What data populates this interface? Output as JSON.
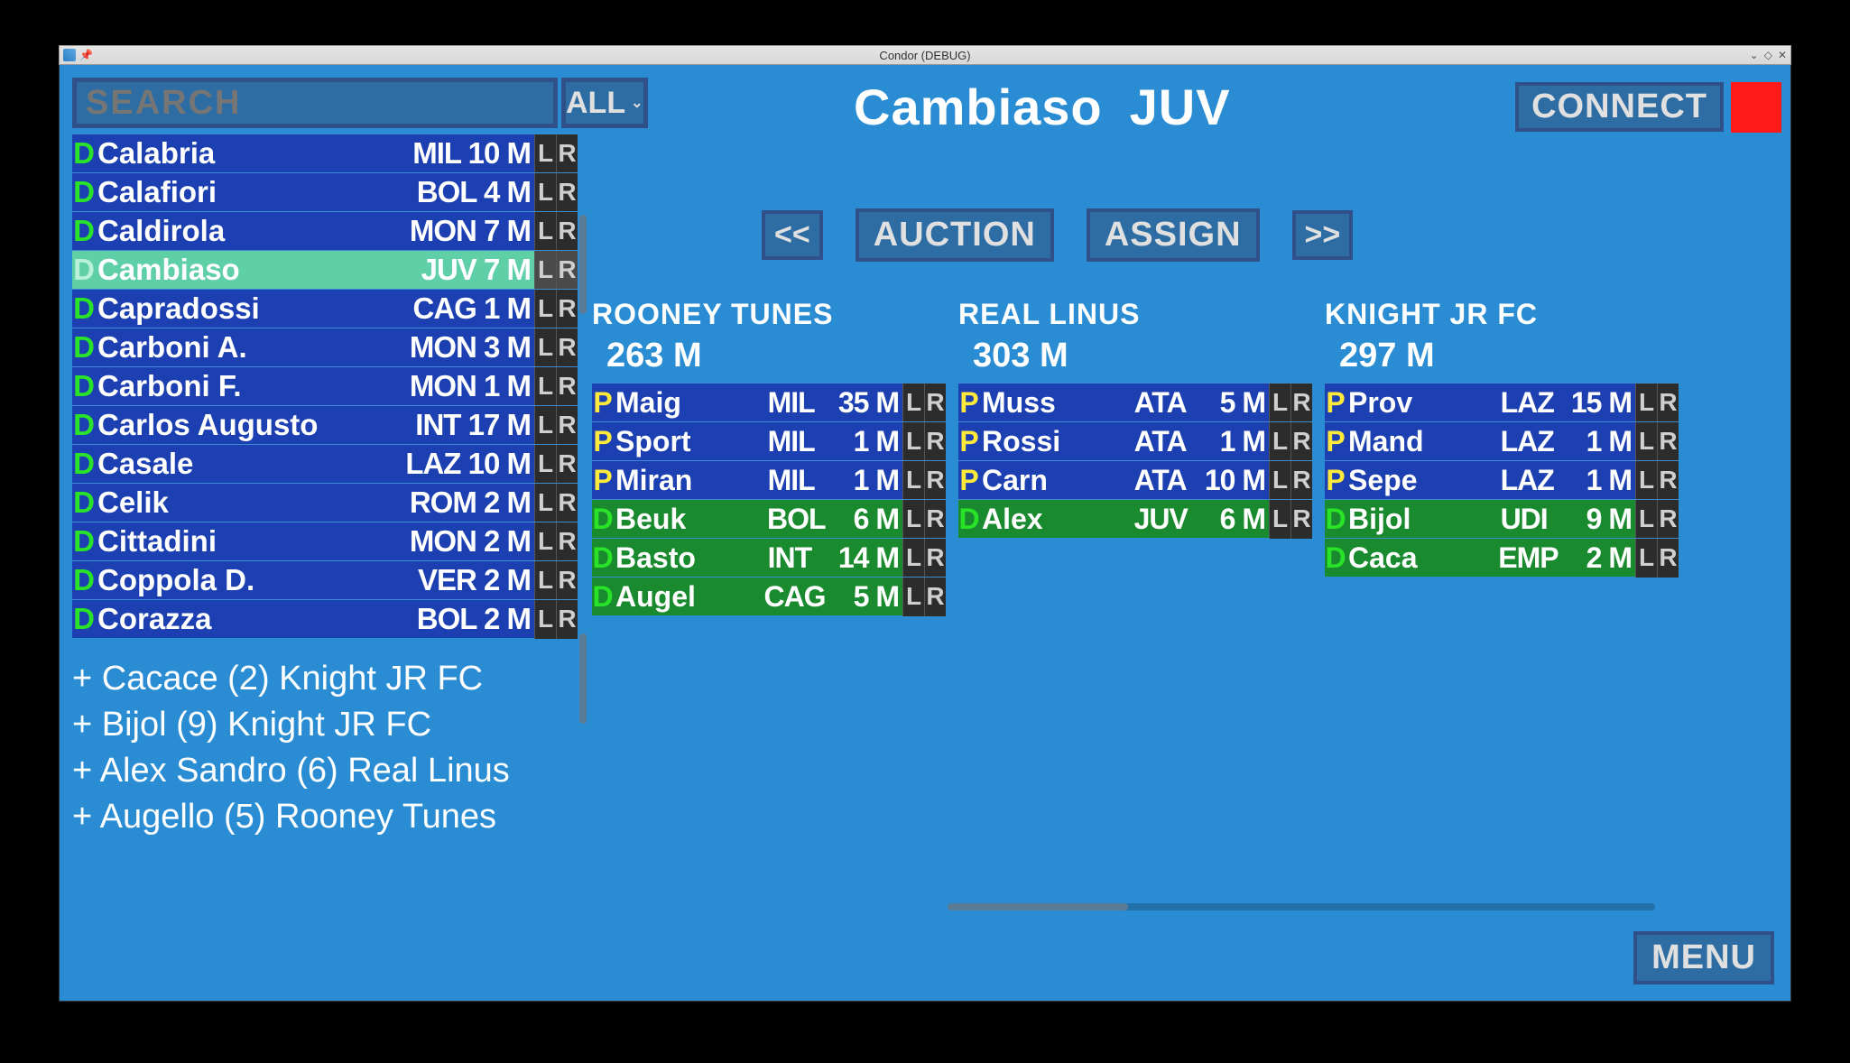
{
  "window": {
    "title": "Condor (DEBUG)"
  },
  "search": {
    "placeholder": "SEARCH",
    "filter_label": "ALL"
  },
  "player_list": [
    {
      "role": "D",
      "name": "Calabria",
      "team": "MIL",
      "value": "10",
      "unit": "M",
      "selected": false
    },
    {
      "role": "D",
      "name": "Calafiori",
      "team": "BOL",
      "value": "4",
      "unit": "M",
      "selected": false
    },
    {
      "role": "D",
      "name": "Caldirola",
      "team": "MON",
      "value": "7",
      "unit": "M",
      "selected": false
    },
    {
      "role": "D",
      "name": "Cambiaso",
      "team": "JUV",
      "value": "7",
      "unit": "M",
      "selected": true
    },
    {
      "role": "D",
      "name": "Capradossi",
      "team": "CAG",
      "value": "1",
      "unit": "M",
      "selected": false
    },
    {
      "role": "D",
      "name": "Carboni A.",
      "team": "MON",
      "value": "3",
      "unit": "M",
      "selected": false
    },
    {
      "role": "D",
      "name": "Carboni F.",
      "team": "MON",
      "value": "1",
      "unit": "M",
      "selected": false
    },
    {
      "role": "D",
      "name": "Carlos Augusto",
      "team": "INT",
      "value": "17",
      "unit": "M",
      "selected": false
    },
    {
      "role": "D",
      "name": "Casale",
      "team": "LAZ",
      "value": "10",
      "unit": "M",
      "selected": false
    },
    {
      "role": "D",
      "name": "Celik",
      "team": "ROM",
      "value": "2",
      "unit": "M",
      "selected": false
    },
    {
      "role": "D",
      "name": "Cittadini",
      "team": "MON",
      "value": "2",
      "unit": "M",
      "selected": false
    },
    {
      "role": "D",
      "name": "Coppola D.",
      "team": "VER",
      "value": "2",
      "unit": "M",
      "selected": false
    },
    {
      "role": "D",
      "name": "Corazza",
      "team": "BOL",
      "value": "2",
      "unit": "M",
      "selected": false
    }
  ],
  "log": [
    "+ Cacace (2) Knight JR FC",
    "+ Bijol (9) Knight JR FC",
    "+ Alex Sandro (6) Real Linus",
    "+ Augello (5) Rooney Tunes"
  ],
  "selected": {
    "name": "Cambiaso",
    "team": "JUV"
  },
  "buttons": {
    "connect": "CONNECT",
    "prev": "<<",
    "auction": "AUCTION",
    "assign": "ASSIGN",
    "next": ">>",
    "menu": "MENU"
  },
  "teams": [
    {
      "name": "ROONEY TUNES",
      "budget": "263 M",
      "players": [
        {
          "role": "P",
          "name": "Maig",
          "team": "MIL",
          "value": "35",
          "unit": "M"
        },
        {
          "role": "P",
          "name": "Sport",
          "team": "MIL",
          "value": "1",
          "unit": "M"
        },
        {
          "role": "P",
          "name": "Miran",
          "team": "MIL",
          "value": "1",
          "unit": "M"
        },
        {
          "role": "D",
          "name": "Beuk",
          "team": "BOL",
          "value": "6",
          "unit": "M"
        },
        {
          "role": "D",
          "name": "Basto",
          "team": "INT",
          "value": "14",
          "unit": "M"
        },
        {
          "role": "D",
          "name": "Augel",
          "team": "CAG",
          "value": "5",
          "unit": "M"
        }
      ]
    },
    {
      "name": "REAL LINUS",
      "budget": "303 M",
      "players": [
        {
          "role": "P",
          "name": "Muss",
          "team": "ATA",
          "value": "5",
          "unit": "M"
        },
        {
          "role": "P",
          "name": "Rossi",
          "team": "ATA",
          "value": "1",
          "unit": "M"
        },
        {
          "role": "P",
          "name": "Carn",
          "team": "ATA",
          "value": "10",
          "unit": "M"
        },
        {
          "role": "D",
          "name": "Alex",
          "team": "JUV",
          "value": "6",
          "unit": "M"
        }
      ]
    },
    {
      "name": "KNIGHT JR FC",
      "budget": "297 M",
      "players": [
        {
          "role": "P",
          "name": "Prov",
          "team": "LAZ",
          "value": "15",
          "unit": "M"
        },
        {
          "role": "P",
          "name": "Mand",
          "team": "LAZ",
          "value": "1",
          "unit": "M"
        },
        {
          "role": "P",
          "name": "Sepe",
          "team": "LAZ",
          "value": "1",
          "unit": "M"
        },
        {
          "role": "D",
          "name": "Bijol",
          "team": "UDI",
          "value": "9",
          "unit": "M"
        },
        {
          "role": "D",
          "name": "Caca",
          "team": "EMP",
          "value": "2",
          "unit": "M"
        }
      ]
    }
  ]
}
